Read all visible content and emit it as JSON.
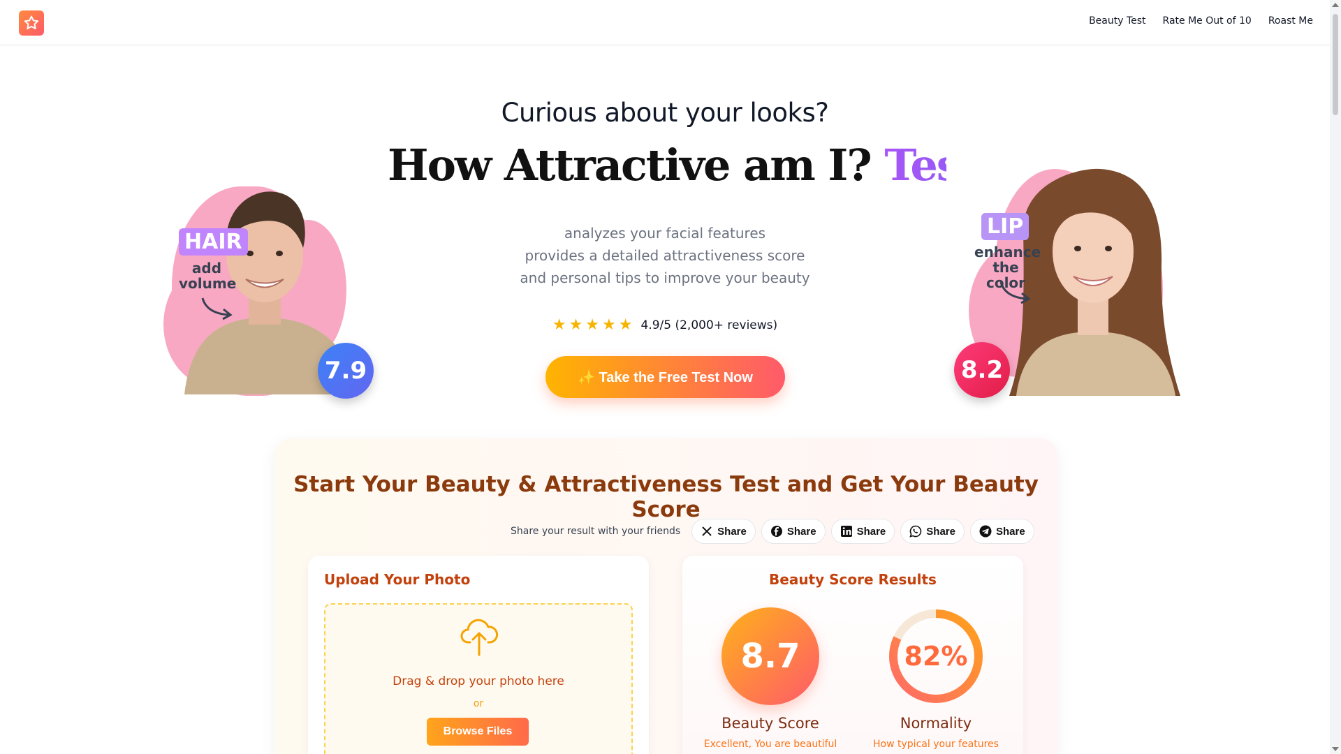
{
  "header": {
    "logo_icon": "star-icon",
    "nav": [
      "Beauty Test",
      "Rate Me Out of 10",
      "Roast Me"
    ]
  },
  "hero": {
    "kicker": "Curious about your looks?",
    "title_main": "How Attractive am I?",
    "title_accent": "Test it now",
    "description": [
      "analyzes your facial features",
      "provides a detailed attractiveness score",
      "and personal tips to improve your beauty"
    ],
    "rating": {
      "stars": 5,
      "text": "4.9/5 (2,000+ reviews)"
    },
    "cta": "✨ Take the Free Test Now"
  },
  "portraits": {
    "left": {
      "tag": "HAIR",
      "note_line1": "add",
      "note_line2": "volume",
      "score": "7.9"
    },
    "right": {
      "tag": "LIP",
      "note_line1": "enhance",
      "note_line2": "the color",
      "score": "8.2"
    }
  },
  "card": {
    "title": "Start Your Beauty & Attractiveness Test and Get Your Beauty Score",
    "share_label": "Share your result with your friends",
    "share_buttons": [
      {
        "icon": "x-icon",
        "label": "Share"
      },
      {
        "icon": "facebook-icon",
        "label": "Share"
      },
      {
        "icon": "linkedin-icon",
        "label": "Share"
      },
      {
        "icon": "whatsapp-icon",
        "label": "Share"
      },
      {
        "icon": "telegram-icon",
        "label": "Share"
      }
    ],
    "upload": {
      "title": "Upload Your Photo",
      "drop_text": "Drag & drop your photo here",
      "or": "or",
      "browse": "Browse Files"
    },
    "results": {
      "title": "Beauty Score Results",
      "beauty_score": "8.7",
      "beauty_label": "Beauty Score",
      "beauty_sub": "Excellent, You are beautiful",
      "normality": "82%",
      "normality_fraction": 0.82,
      "normality_label": "Normality",
      "normality_sub": "How typical your features"
    }
  },
  "colors": {
    "accent": "#ff6a3d",
    "purple": "#a855f7",
    "title": "#8a3a0c"
  }
}
